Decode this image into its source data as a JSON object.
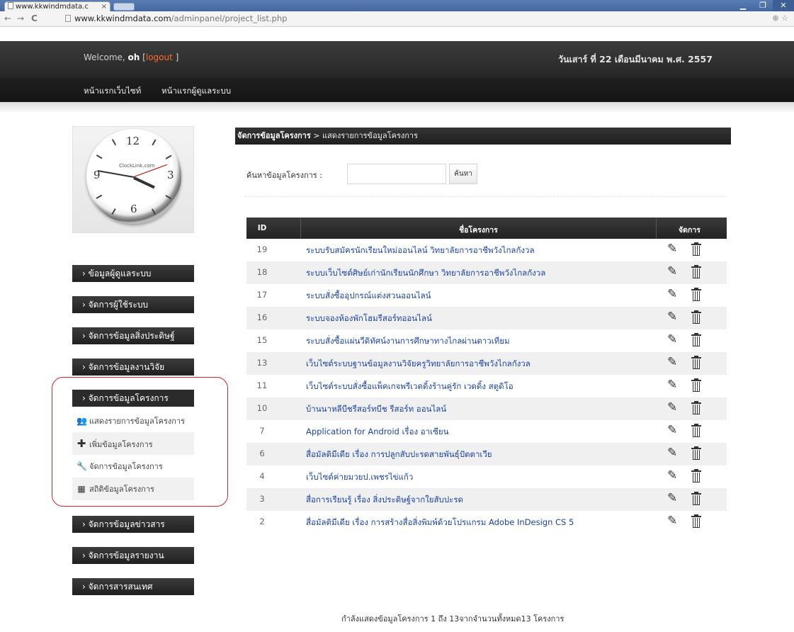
{
  "browser": {
    "tab_title": "www.kkwindmdata.c",
    "url_host": "www.kkwindmdata.com",
    "url_path": "/adminpanel/project_list.php"
  },
  "header": {
    "welcome_prefix": "Welcome,",
    "username": "oh",
    "logout_open": "[",
    "logout_label": "logout",
    "logout_close": "]",
    "date": "วันเสาร์ ที่ 22 เดือนมีนาคม พ.ศ. 2557"
  },
  "menu": {
    "home": "หน้าแรกเว็บไซท์",
    "admin_home": "หน้าแรกผู้ดูแลระบบ"
  },
  "clock": {
    "brand": "ClockLink.com",
    "n12": "12",
    "n3": "3",
    "n6": "6",
    "n9": "9"
  },
  "sidebar": {
    "items": [
      "› ข้อมูลผู้ดูแลระบบ",
      "› จัดการผู้ใช้ระบบ",
      "› จัดการข้อมูลสิ่งประดิษฐ์",
      "› จัดการข้อมูลงานวิจัย",
      "› จัดการข้อมูลโครงการ",
      "› จัดการข้อมูลข่าวสาร",
      "› จัดการข้อมูลรายงาน",
      "› จัดการสารสนเทศ"
    ],
    "submenu": [
      {
        "label": "แสดงรายการข้อมูลโครงการ",
        "icon": "users-icon"
      },
      {
        "label": "เพิ่มข้อมูลโครงการ",
        "icon": "plus-icon"
      },
      {
        "label": "จัดการข้อมูลโครงการ",
        "icon": "wrench-icon"
      },
      {
        "label": "สถิติข้อมูลโครงการ",
        "icon": "calendar-icon"
      }
    ]
  },
  "content": {
    "breadcrumb_bold": "จัดการข้อมูลโครงการ",
    "breadcrumb_rest": " > แสดงรายการข้อมูลโครงการ",
    "search_label": "ค้นหาข้อมูลโครงการ :",
    "search_value": "",
    "search_button": "ค้นหา",
    "columns": {
      "id": "ID",
      "name": "ชื่อโครงการ",
      "actions": "จัดการ"
    },
    "rows": [
      {
        "id": "19",
        "name": "ระบบรับสมัครนักเรียนใหม่ออนไลน์ วิทยาลัยการอาชีพวังไกลกังวล"
      },
      {
        "id": "18",
        "name": "ระบบเว็บไซต์ศิษย์เก่านักเรียนนักศึกษา วิทยาลัยการอาชีพวังไกลกังวล"
      },
      {
        "id": "17",
        "name": "ระบบสั่งซื้ออุปกรณ์แต่งสวนออนไลน์"
      },
      {
        "id": "16",
        "name": "ระบบจองห้องพักโฮมรีสอร์ทออนไลน์"
      },
      {
        "id": "15",
        "name": "ระบบสั่งซื้อแผ่นวีดิทัศน์งานการศึกษาทางไกลผ่านดาวเทียม"
      },
      {
        "id": "13",
        "name": "เว็บไซต์ระบบฐานข้อมูลงานวิจัยครูวิทยาลัยการอาชีพวังไกลกังวล"
      },
      {
        "id": "11",
        "name": "เว็บไซต์ระบบสั่งซื้อแพ็คเกจพรีเวดดิ้งร้านคู่รัก เวดดิ้ง สตูดิโอ"
      },
      {
        "id": "10",
        "name": "บ้านนาหลีบีชรีสอร์ทบีช รีสอร์ท ออนไลน์"
      },
      {
        "id": "7",
        "name": "Application for Android เรื่อง อาเซียน"
      },
      {
        "id": "6",
        "name": "สื่อมัลติมีเดีย เรื่อง การปลูกสับปะรดสายพันธุ์ปัตตาเวีย"
      },
      {
        "id": "4",
        "name": "เว็บไซต์ค่ายมวยป.เพชรไข่แก้ว"
      },
      {
        "id": "3",
        "name": "สื่อการเรียนรู้ เรื่อง สิ่งประดิษฐ์จากใยสับปะรด"
      },
      {
        "id": "2",
        "name": "สื่อมัลติมีเดีย เรื่อง การสร้างสื่อสิ่งพิมพ์ด้วยโปรแกรม Adobe InDesign CS 5"
      }
    ],
    "footer": "กำลังแสดงข้อมูลโครงการ 1 ถึง 13จากจำนวนทั้งหมด13 โครงการ"
  },
  "colors": {
    "link": "#1a43a8",
    "logout": "#ff6a2a",
    "highlight_oval": "#dd2222"
  }
}
